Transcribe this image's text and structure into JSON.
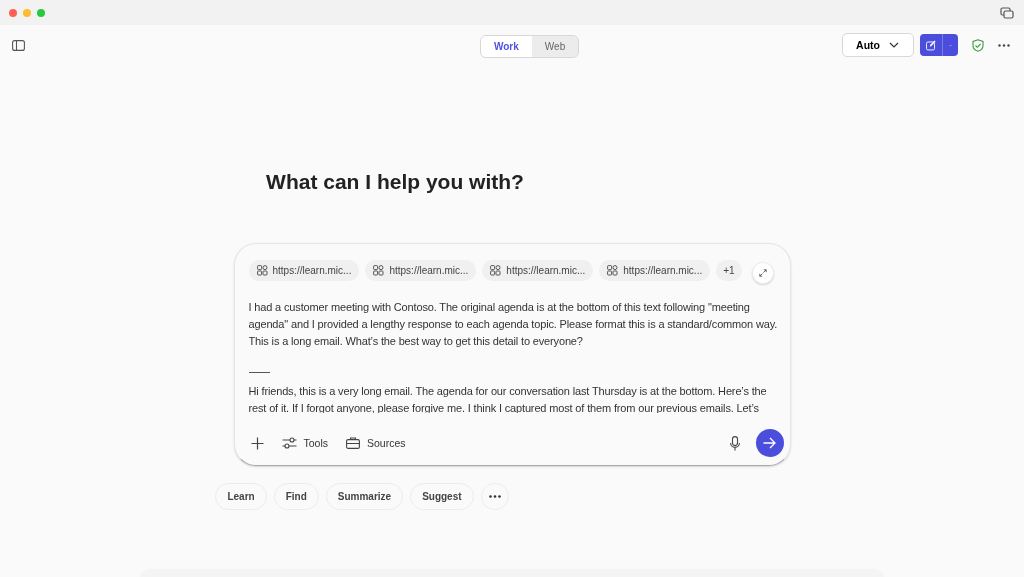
{
  "mode_tabs": [
    {
      "label": "Work",
      "selected": true
    },
    {
      "label": "Web",
      "selected": false
    }
  ],
  "model_picker": {
    "value": "Auto"
  },
  "heading": "What can I help you with?",
  "composer": {
    "attachments": [
      {
        "label": "https://learn.mic..."
      },
      {
        "label": "https://learn.mic..."
      },
      {
        "label": "https://learn.mic..."
      },
      {
        "label": "https://learn.mic..."
      }
    ],
    "more_attachments": "+1",
    "paragraphs": [
      "I had a customer meeting with Contoso. The original agenda is at the bottom of this text following \"meeting agenda\" and I provided a lengthy response to each agenda topic. Please format this is a standard/common way. This is a long email. What’s the best way to get this detail to everyone?",
      "Hi friends, this is a very long email. The agenda for our conversation last Thursday is at the bottom.  Here’s the rest of it. If I forgot anyone, please forgive me. I think I captured most of them from our previous emails. Let’s"
    ],
    "tools": [
      {
        "label": "Tools",
        "kind": "sliders"
      },
      {
        "label": "Sources",
        "kind": "briefcase"
      }
    ]
  },
  "suggestions": [
    {
      "label": "Learn"
    },
    {
      "label": "Find"
    },
    {
      "label": "Summarize"
    },
    {
      "label": "Suggest"
    }
  ]
}
